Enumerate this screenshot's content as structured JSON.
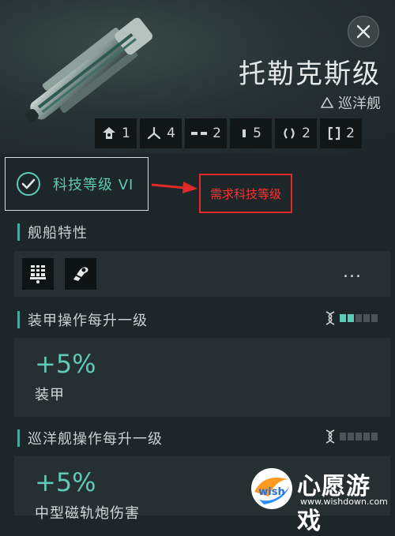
{
  "ship": {
    "name": "托勒克斯级",
    "class_label": "巡洋舰",
    "icon": "ship-render"
  },
  "slots": [
    {
      "icon": "high-slot-icon",
      "count": "1"
    },
    {
      "icon": "turret-hardpoint-icon",
      "count": "4"
    },
    {
      "icon": "mid-slot-icon",
      "count": "2"
    },
    {
      "icon": "low-slot-icon",
      "count": "5"
    },
    {
      "icon": "rig-slot-icon",
      "count": "2"
    },
    {
      "icon": "subsystem-slot-icon",
      "count": "2"
    }
  ],
  "tech": {
    "label": "科技等级 VI",
    "annotation": "需求科技等级",
    "annotation_color": "#e02a2a"
  },
  "traits": {
    "title": "舰船特性",
    "icons": [
      "armor-repair-icon",
      "railgun-icon"
    ],
    "more_label": "..."
  },
  "bonuses": [
    {
      "title": "装甲操作每升一级",
      "value": "+5%",
      "label": "装甲",
      "level": 2,
      "max_level": 5
    },
    {
      "title": "巡洋舰操作每升一级",
      "value": "+5%",
      "label": "中型磁轨炮伤害",
      "level": 0,
      "max_level": 5
    }
  ],
  "watermark": {
    "text": "心愿游戏",
    "url": "www.wishdown.com",
    "badge": "wish"
  },
  "colors": {
    "accent": "#5fcab8",
    "background": "#1d2628",
    "panel": "#263032"
  }
}
